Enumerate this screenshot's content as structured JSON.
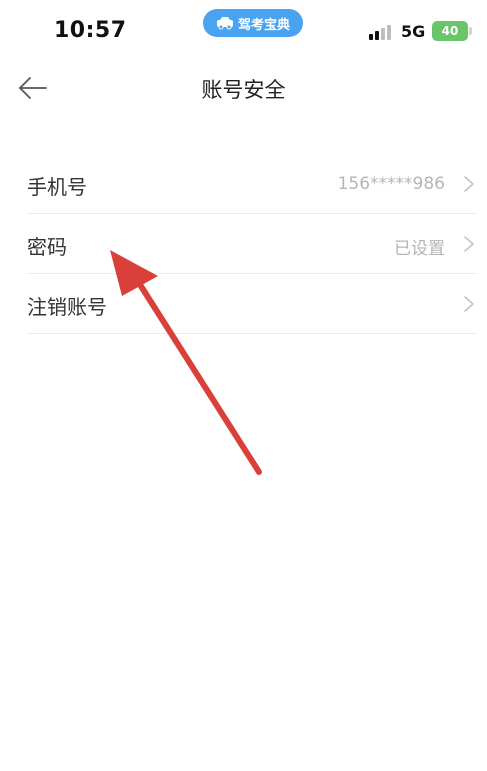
{
  "status_bar": {
    "time": "10:57",
    "network": "5G",
    "battery": "40",
    "app_pill": {
      "label": "驾考宝典",
      "icon": "car-icon"
    }
  },
  "nav": {
    "title": "账号安全",
    "back_icon": "arrow-left-icon"
  },
  "settings": {
    "items": [
      {
        "label": "手机号",
        "value": "156*****986"
      },
      {
        "label": "密码",
        "value": "已设置"
      },
      {
        "label": "注销账号",
        "value": ""
      }
    ],
    "chevron_icon": "chevron-right-icon"
  },
  "colors": {
    "accent_pill": "#4aa3f0",
    "battery": "#6ac46a",
    "annotation_arrow": "#d9403a",
    "divider": "#ebebeb",
    "secondary_text": "#b5b5b5"
  }
}
